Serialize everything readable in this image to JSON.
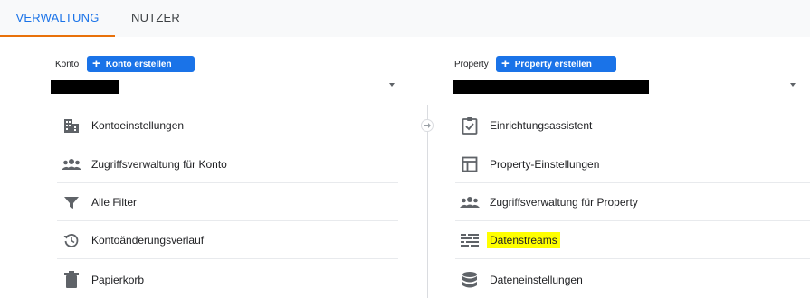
{
  "tabs": [
    {
      "label": "VERWALTUNG"
    },
    {
      "label": "NUTZER"
    }
  ],
  "account": {
    "label": "Konto",
    "create_button": "Konto erstellen",
    "items": [
      {
        "label": "Kontoeinstellungen",
        "icon": "building-icon"
      },
      {
        "label": "Zugriffsverwaltung für Konto",
        "icon": "people-icon"
      },
      {
        "label": "Alle Filter",
        "icon": "filter-icon"
      },
      {
        "label": "Kontoänderungsverlauf",
        "icon": "history-icon"
      },
      {
        "label": "Papierkorb",
        "icon": "trash-icon"
      }
    ]
  },
  "property": {
    "label": "Property",
    "create_button": "Property erstellen",
    "items": [
      {
        "label": "Einrichtungsassistent",
        "icon": "clipboard-check-icon"
      },
      {
        "label": "Property-Einstellungen",
        "icon": "layout-icon"
      },
      {
        "label": "Zugriffsverwaltung für Property",
        "icon": "people-icon"
      },
      {
        "label": "Datenstreams",
        "icon": "data-streams-icon",
        "highlighted": true
      },
      {
        "label": "Dateneinstellungen",
        "icon": "database-icon"
      }
    ]
  },
  "colors": {
    "accent": "#1a73e8",
    "tab_indicator": "#e8710a",
    "highlight": "#ffff00",
    "icon": "#5f6368"
  }
}
